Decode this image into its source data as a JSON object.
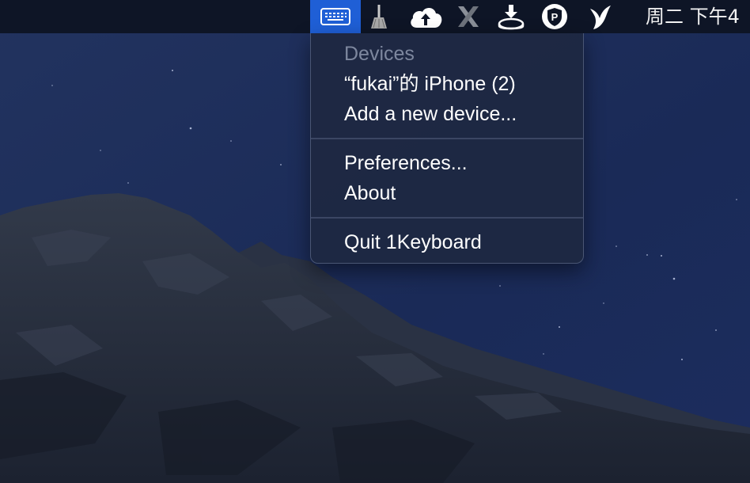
{
  "menubar": {
    "icons": [
      {
        "name": "keyboard-icon",
        "active": true
      },
      {
        "name": "broom-icon"
      },
      {
        "name": "cloud-sync-icon"
      },
      {
        "name": "x-app-icon"
      },
      {
        "name": "download-disk-icon"
      },
      {
        "name": "shield-p-icon"
      },
      {
        "name": "bird-icon"
      }
    ],
    "clock": "周二 下午4"
  },
  "menu": {
    "section_header": "Devices",
    "device_item": "“fukai”的 iPhone (2)",
    "add_device": "Add a new device...",
    "preferences": "Preferences...",
    "about": "About",
    "quit": "Quit 1Keyboard"
  },
  "colors": {
    "menubar_bg": "#0e1526",
    "active_highlight": "#1f5fd6",
    "menu_bg": "#1e2842",
    "menu_text": "#ffffff",
    "disabled_text": "#7d879e",
    "sky": "#1b2a55"
  }
}
